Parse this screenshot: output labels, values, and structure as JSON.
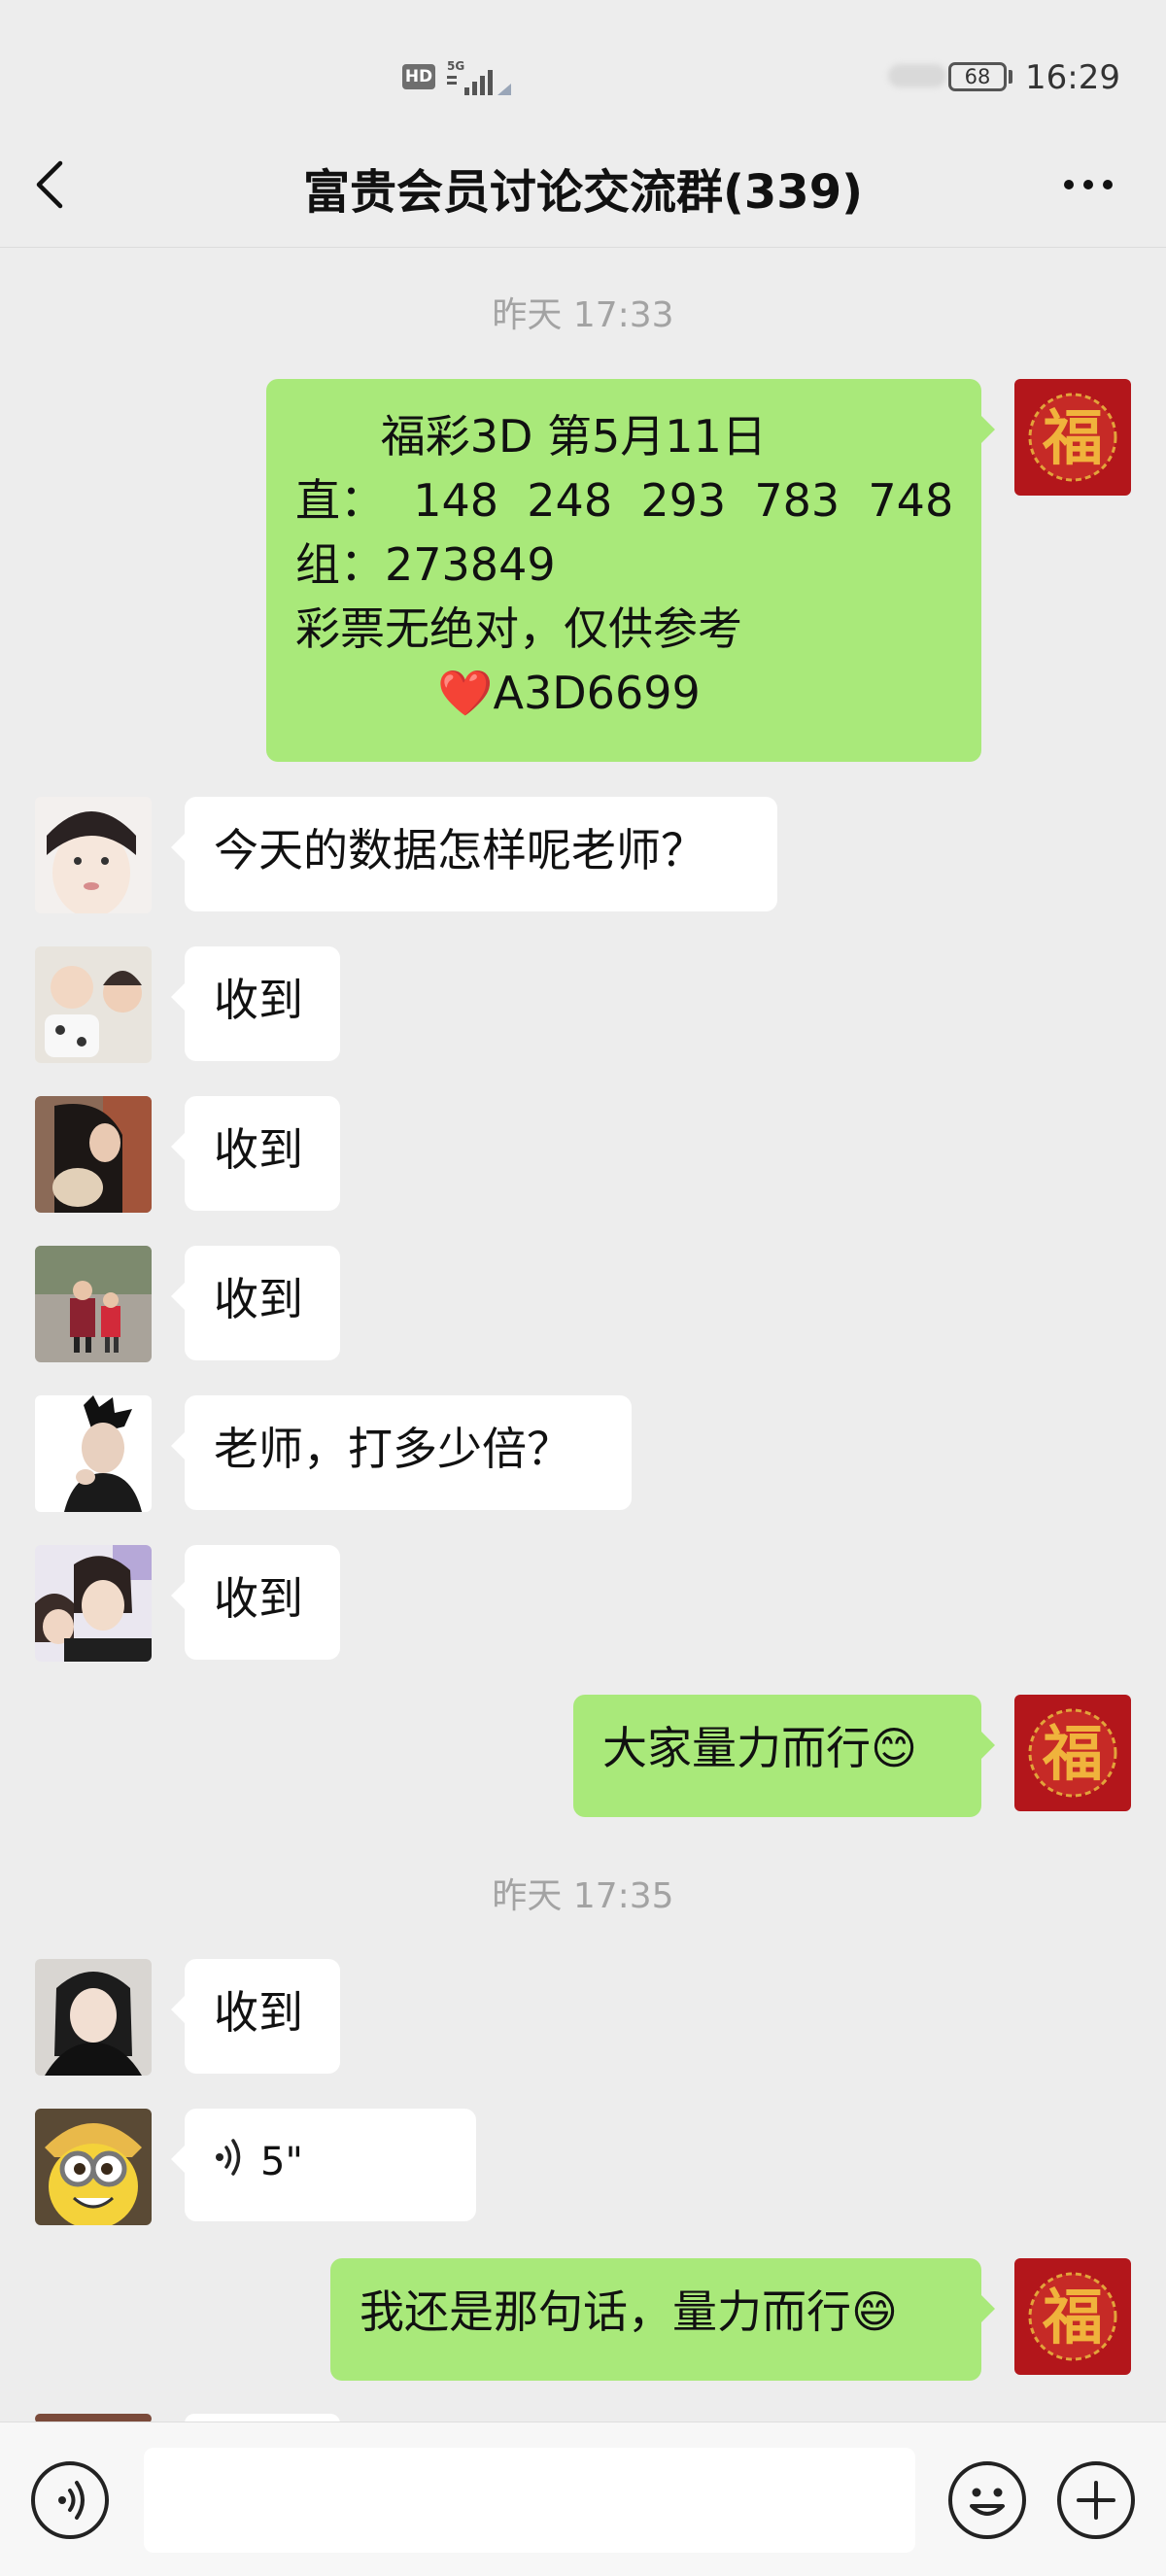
{
  "status_bar": {
    "hd": "HD",
    "network": "5G",
    "battery": "68",
    "time": "16:29"
  },
  "header": {
    "title": "富贵会员讨论交流群(339)"
  },
  "timestamps": [
    "昨天 17:33",
    "昨天 17:35"
  ],
  "messages": [
    {
      "side": "out",
      "lines": [
        "      福彩3D 第5月11日",
        "直：  148  248  293  783  748",
        "组：273849",
        "彩票无绝对，仅供参考"
      ],
      "heart_line": "A3D6699",
      "heart": "❤️"
    },
    {
      "side": "in",
      "text": "今天的数据怎样呢老师？"
    },
    {
      "side": "in",
      "text": "收到"
    },
    {
      "side": "in",
      "text": "收到"
    },
    {
      "side": "in",
      "text": "收到"
    },
    {
      "side": "in",
      "text": "老师，打多少倍？"
    },
    {
      "side": "in",
      "text": "收到"
    },
    {
      "side": "out",
      "text": "大家量力而行😊"
    },
    {
      "side": "in",
      "text": "收到"
    },
    {
      "side": "in",
      "text": "5\""
    },
    {
      "side": "out",
      "text": "我还是那句话，量力而行😄"
    }
  ],
  "input": {
    "value": ""
  },
  "colors": {
    "background": "#ededed",
    "outgoing_bubble": "#a9e97a",
    "incoming_bubble": "#ffffff",
    "timestamp": "#a3a3a3"
  }
}
